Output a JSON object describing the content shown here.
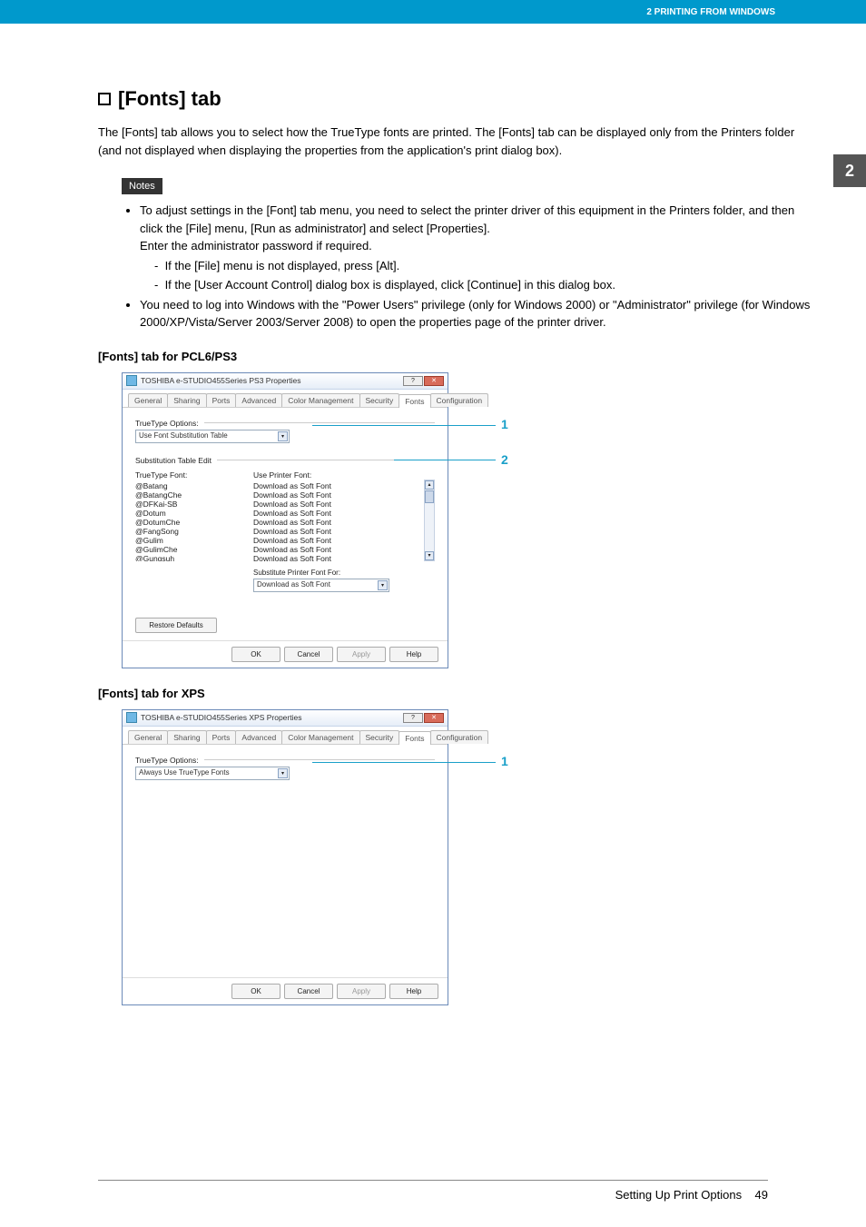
{
  "header": {
    "section": "2 PRINTING FROM WINDOWS"
  },
  "side_tab": "2",
  "title": "[Fonts] tab",
  "intro": "The [Fonts] tab allows you to select how the TrueType fonts are printed. The [Fonts] tab can be displayed only from the Printers folder (and not displayed when displaying the properties from the application's print dialog box).",
  "notes_label": "Notes",
  "notes": {
    "b1": "To adjust settings in the [Font] tab menu, you need to select the printer driver of this equipment in the Printers folder, and then click the [File] menu, [Run as administrator] and select [Properties].",
    "b1a": "Enter the administrator password if required.",
    "b1_sub1": "If the [File] menu is not displayed, press [Alt].",
    "b1_sub2": "If the [User Account Control] dialog box is displayed, click [Continue] in this dialog box.",
    "b2": "You need to log into Windows with the \"Power Users\" privilege (only for Windows 2000) or \"Administrator\" privilege (for Windows 2000/XP/Vista/Server 2003/Server 2008) to open the properties page of the printer driver."
  },
  "subhead1": "[Fonts] tab for PCL6/PS3",
  "subhead2": "[Fonts] tab for XPS",
  "dialog1": {
    "title": "TOSHIBA e-STUDIO455Series PS3 Properties",
    "tabs": [
      "General",
      "Sharing",
      "Ports",
      "Advanced",
      "Color Management",
      "Security",
      "Fonts",
      "Configuration"
    ],
    "active_tab": "Fonts",
    "truetype_label": "TrueType Options:",
    "truetype_value": "Use Font Substitution Table",
    "subst_label": "Substitution Table Edit",
    "col1": "TrueType Font:",
    "col2": "Use Printer Font:",
    "fonts": [
      {
        "t": "@Batang",
        "p": "Download as Soft Font"
      },
      {
        "t": "@BatangChe",
        "p": "Download as Soft Font"
      },
      {
        "t": "@DFKai-SB",
        "p": "Download as Soft Font"
      },
      {
        "t": "@Dotum",
        "p": "Download as Soft Font"
      },
      {
        "t": "@DotumChe",
        "p": "Download as Soft Font"
      },
      {
        "t": "@FangSong",
        "p": "Download as Soft Font"
      },
      {
        "t": "@Gulim",
        "p": "Download as Soft Font"
      },
      {
        "t": "@GulimChe",
        "p": "Download as Soft Font"
      },
      {
        "t": "@Gungsuh",
        "p": "Download as Soft Font"
      }
    ],
    "sub_label": "Substitute Printer Font For:",
    "sub_value": "Download as Soft Font",
    "restore": "Restore Defaults",
    "ok": "OK",
    "cancel": "Cancel",
    "apply": "Apply",
    "help": "Help",
    "callout1": "1",
    "callout2": "2"
  },
  "dialog2": {
    "title": "TOSHIBA e-STUDIO455Series XPS Properties",
    "tabs": [
      "General",
      "Sharing",
      "Ports",
      "Advanced",
      "Color Management",
      "Security",
      "Fonts",
      "Configuration"
    ],
    "active_tab": "Fonts",
    "truetype_label": "TrueType Options:",
    "truetype_value": "Always Use TrueType Fonts",
    "ok": "OK",
    "cancel": "Cancel",
    "apply": "Apply",
    "help": "Help",
    "callout1": "1"
  },
  "footer": {
    "text": "Setting Up Print Options",
    "page": "49"
  }
}
